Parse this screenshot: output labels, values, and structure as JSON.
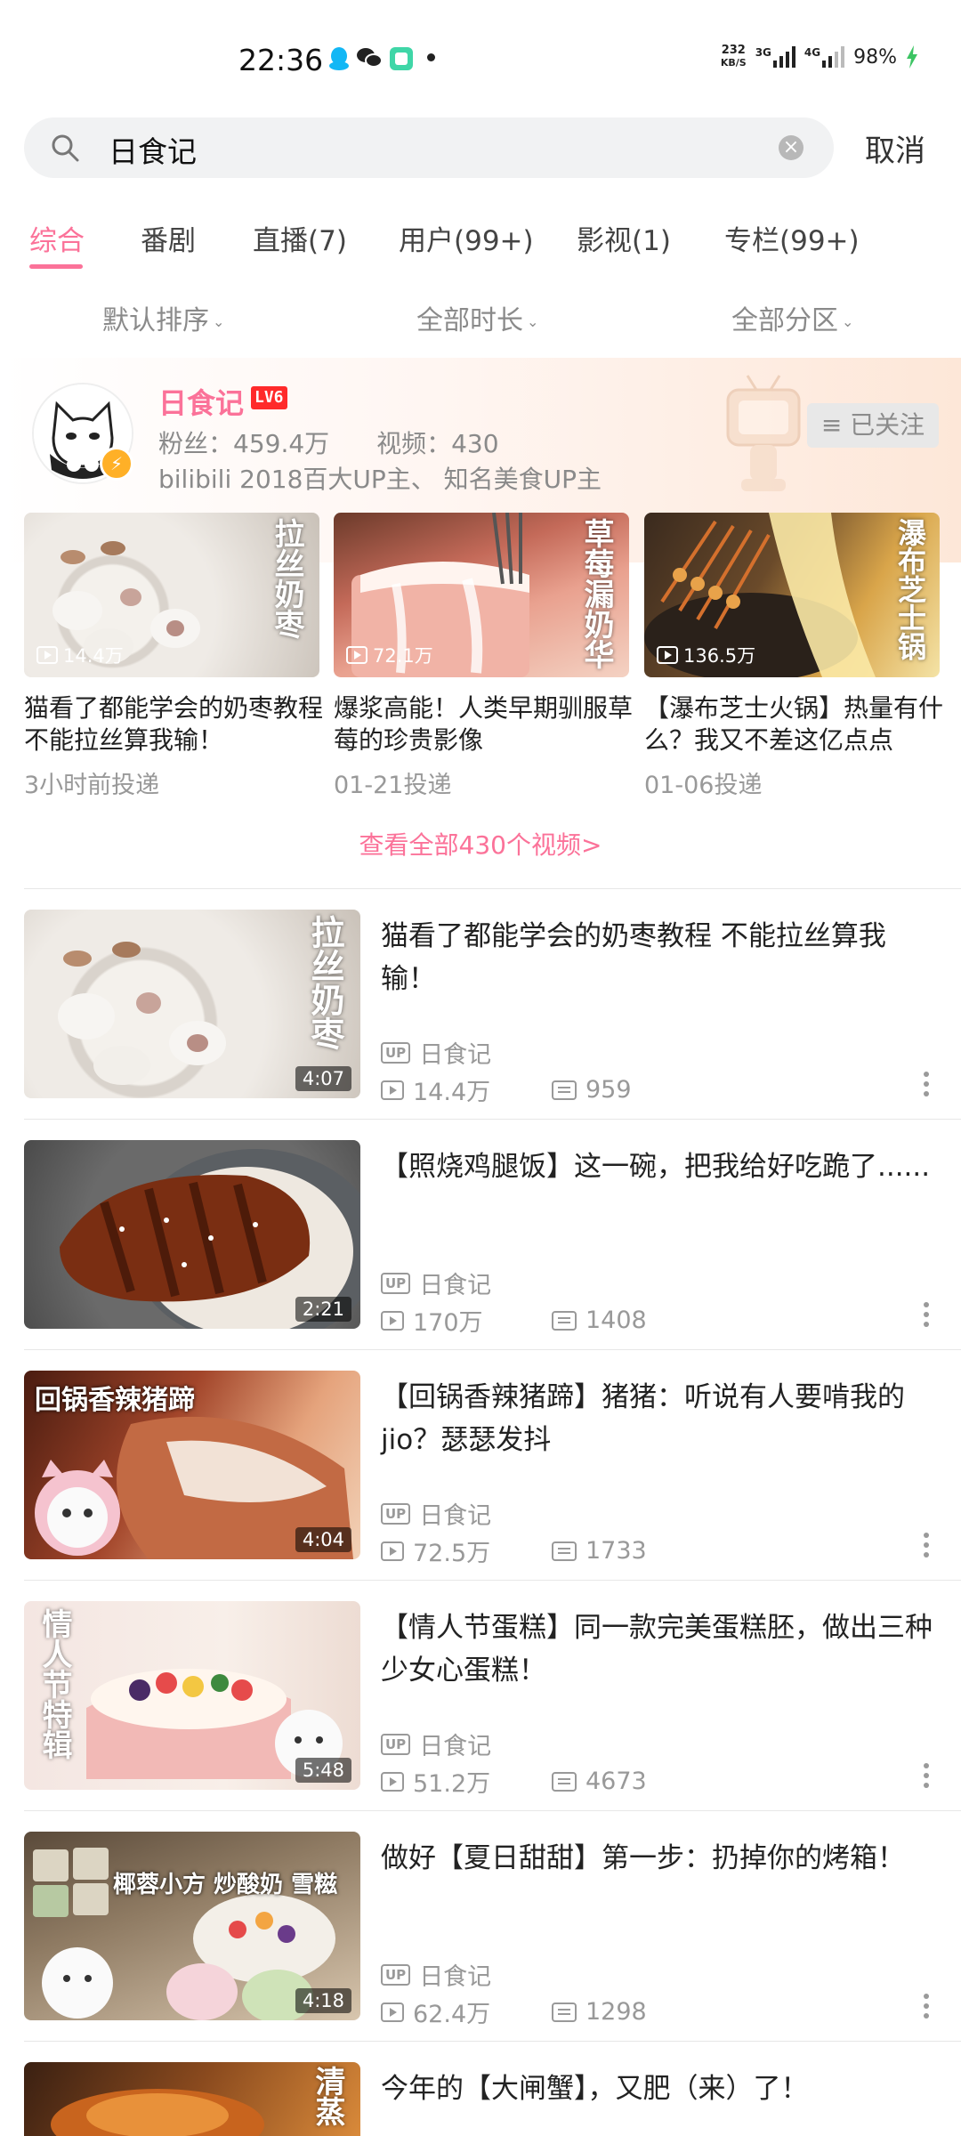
{
  "status_bar": {
    "time": "22:36",
    "net_speed_value": "232",
    "net_speed_unit": "KB/S",
    "net1": "3G",
    "net2": "4G",
    "battery": "98%"
  },
  "search": {
    "query": "日食记",
    "cancel_label": "取消"
  },
  "tabs": [
    {
      "label": "综合",
      "active": true
    },
    {
      "label": "番剧"
    },
    {
      "label": "直播(7)"
    },
    {
      "label": "用户(99+)"
    },
    {
      "label": "影视(1)"
    },
    {
      "label": "专栏(99+)"
    }
  ],
  "filters": [
    "默认排序",
    "全部时长",
    "全部分区"
  ],
  "user_card": {
    "name": "日食记",
    "level": "LV6",
    "fans": "粉丝：459.4万",
    "videos": "视频：430",
    "desc": "bilibili 2018百大UP主、 知名美食UP主",
    "follow_label": "≡ 已关注"
  },
  "grid_videos": [
    {
      "views": "14.4万",
      "title": "猫看了都能学会的奶枣教程不能拉丝算我输！",
      "time": "3小时前投递",
      "overlay": "拉丝奶枣"
    },
    {
      "views": "72.1万",
      "title": "爆浆高能！人类早期驯服草莓的珍贵影像",
      "time": "01-21投递",
      "overlay": "草莓漏奶华"
    },
    {
      "views": "136.5万",
      "title": "【瀑布芝士火锅】热量有什么？我又不差这亿点点",
      "time": "01-06投递",
      "overlay": "瀑布芝士锅"
    }
  ],
  "view_all": "查看全部430个视频>",
  "list_videos": [
    {
      "title": "猫看了都能学会的奶枣教程 不能拉丝算我输！",
      "duration": "4:07",
      "up": "日食记",
      "views": "14.4万",
      "danmaku": "959",
      "overlay": "拉丝奶枣"
    },
    {
      "title": "【照烧鸡腿饭】这一碗，把我给好吃跪了......",
      "duration": "2:21",
      "up": "日食记",
      "views": "170万",
      "danmaku": "1408",
      "overlay": ""
    },
    {
      "title": "【回锅香辣猪蹄】猪猪：听说有人要啃我的jio？瑟瑟发抖",
      "duration": "4:04",
      "up": "日食记",
      "views": "72.5万",
      "danmaku": "1733",
      "overlay": "回锅香辣猪蹄"
    },
    {
      "title": "【情人节蛋糕】同一款完美蛋糕胚，做出三种少女心蛋糕！",
      "duration": "5:48",
      "up": "日食记",
      "views": "51.2万",
      "danmaku": "4673",
      "overlay": "情人节特辑"
    },
    {
      "title": "做好【夏日甜甜】第一步：扔掉你的烤箱！",
      "duration": "4:18",
      "up": "日食记",
      "views": "62.4万",
      "danmaku": "1298",
      "overlay": "椰蓉小方 炒酸奶 雪糍"
    },
    {
      "title": "今年的【大闸蟹】，又肥（来）了！",
      "duration": "",
      "up": "",
      "views": "",
      "danmaku": "",
      "overlay": "清蒸"
    }
  ],
  "up_badge": "UP",
  "colors": {
    "accent": "#fb7299",
    "muted": "#999999"
  }
}
